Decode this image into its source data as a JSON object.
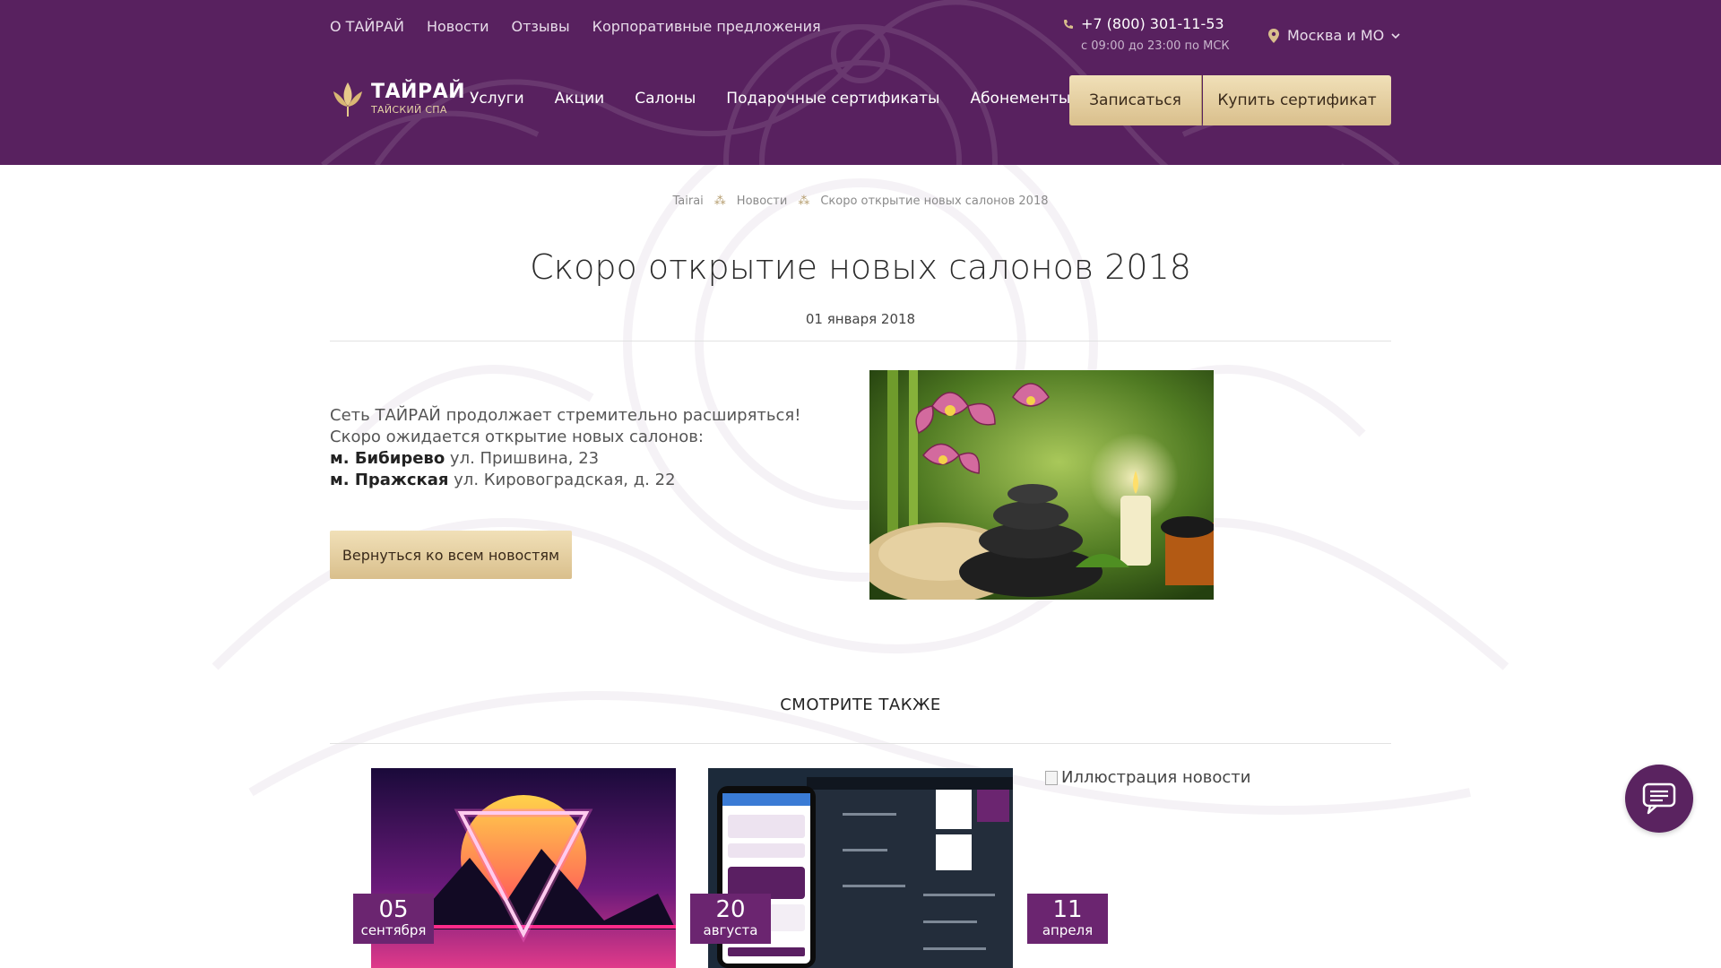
{
  "header": {
    "top_links": [
      "О ТАЙРАЙ",
      "Новости",
      "Отзывы",
      "Корпоративные предложения"
    ],
    "phone": "+7 (800) 301-11-53",
    "hours": "с 09:00 до 23:00 по МСК",
    "city": "Москва и МО",
    "logo": {
      "title": "ТАЙРАЙ",
      "subtitle": "ТАЙСКИЙ СПА"
    },
    "main_nav": [
      "Услуги",
      "Акции",
      "Салоны",
      "Подарочные сертификаты",
      "Абонементы"
    ],
    "signup_label": "Записаться",
    "cert_label": "Купить сертификат",
    "colors": {
      "bg": "#58215f",
      "gold": "#d9bf8c"
    }
  },
  "breadcrumb": [
    "Tairai",
    "Новости",
    "Скоро открытие новых салонов 2018"
  ],
  "article": {
    "title": "Скоро открытие новых салонов 2018",
    "date": "01 января 2018",
    "intro": "Сеть ТАЙРАЙ продолжает стремительно расширяться! Скоро ожидается открытие новых салонов:",
    "salons": [
      {
        "metro": "м. Бибирево",
        "address": "ул. Пришвина, 23"
      },
      {
        "metro": "м. Пражская",
        "address": "ул. Кировоградская, д. 22"
      }
    ],
    "back_label": "Вернуться ко всем новостям"
  },
  "see_also": {
    "title": "СМОТРИТЕ ТАКЖЕ",
    "cards": [
      {
        "day": "05",
        "month": "сентября"
      },
      {
        "day": "20",
        "month": "августа"
      },
      {
        "day": "11",
        "month": "апреля",
        "alt": "Иллюстрация новости"
      }
    ]
  },
  "icons": [
    "phone-icon",
    "location-pin-icon",
    "chevron-down-icon",
    "lotus-logo-icon",
    "chat-icon"
  ]
}
